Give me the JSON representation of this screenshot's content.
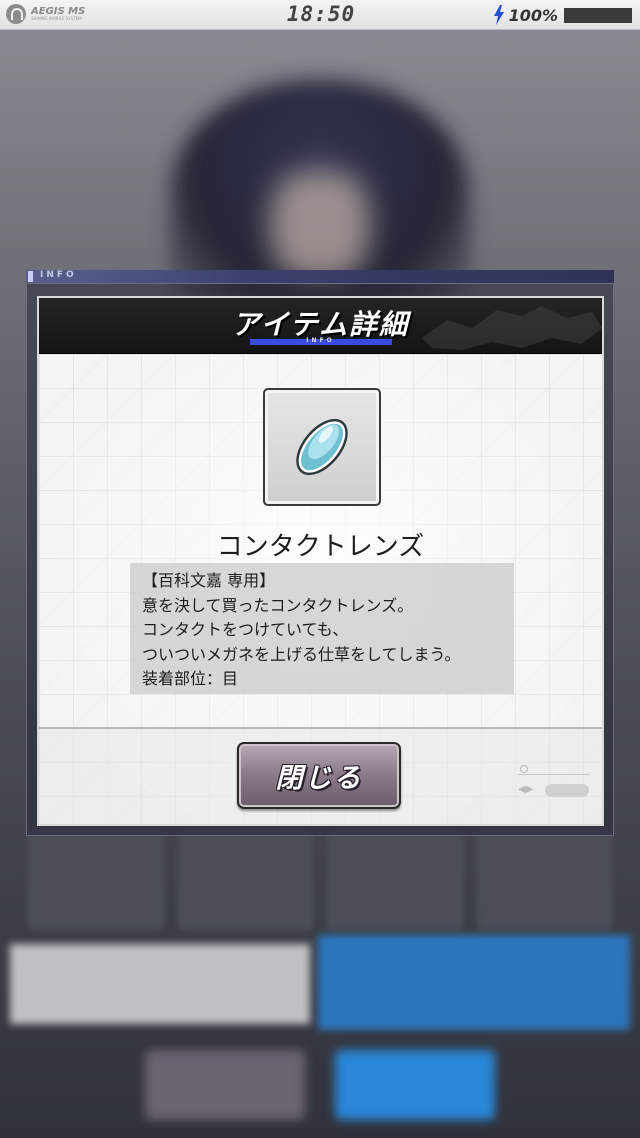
{
  "status_bar": {
    "app_name": "AEGIS MS",
    "app_subname": "SHINING MOBILE SYSTEM",
    "time": "18:50",
    "battery_percent": "100%",
    "battery_level": 1.0
  },
  "info_strip": {
    "label": "INFO"
  },
  "dialog": {
    "title": "アイテム詳細",
    "title_sub": "INFO",
    "item": {
      "icon": "contact-lens-icon",
      "name": "コンタクトレンズ",
      "description_lines": [
        "【百科文嘉 専用】",
        "意を決して買ったコンタクトレンズ。",
        "コンタクトをつけていても、",
        "ついついメガネを上げる仕草をしてしまう。",
        "装着部位：目"
      ]
    },
    "close_button_label": "閉じる"
  },
  "colors": {
    "header_bg": "#1b1b1b",
    "accent_blue": "#3a4ce0",
    "close_button": "#8c7d8b",
    "lens": "#7fc8d8"
  }
}
